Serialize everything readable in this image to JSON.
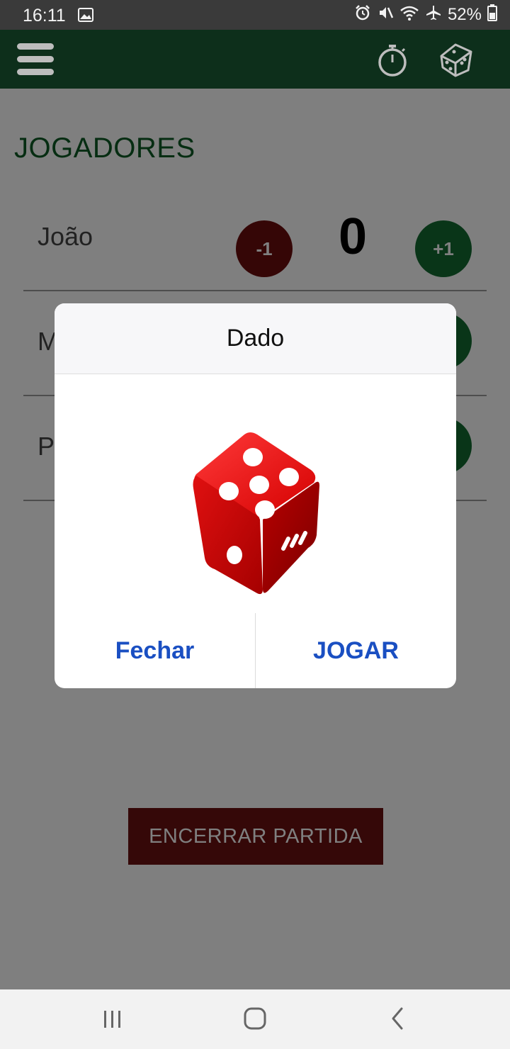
{
  "status_bar": {
    "time": "16:11",
    "battery": "52%",
    "icons": [
      "image-icon",
      "alarm-icon",
      "mute-icon",
      "wifi-icon",
      "airplane-icon",
      "battery-icon"
    ]
  },
  "app_bar": {
    "icons": [
      "menu-icon",
      "stopwatch-icon",
      "dice-icon"
    ],
    "color": "#0d2f1b"
  },
  "main": {
    "section_title": "JOGADORES",
    "players": [
      {
        "name": "João",
        "minus_label": "-1",
        "score": "0",
        "plus_label": "+1"
      },
      {
        "name": "M",
        "minus_label": "",
        "score": "",
        "plus_label": ""
      },
      {
        "name": "P",
        "minus_label": "",
        "score": "",
        "plus_label": ""
      }
    ],
    "end_button": "ENCERRAR PARTIDA"
  },
  "dialog": {
    "title": "Dado",
    "image": "red-dice-showing-five",
    "close_label": "Fechar",
    "play_label": "JOGAR",
    "action_color": "#1a4fc2"
  },
  "nav_bar": {
    "icons": [
      "recent-apps-icon",
      "home-icon",
      "back-icon"
    ]
  }
}
